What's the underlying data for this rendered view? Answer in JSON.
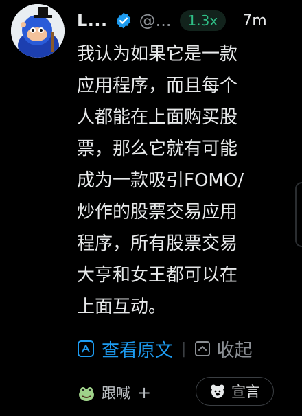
{
  "header": {
    "name": "L...",
    "handle": "@...",
    "speed": "1.3x",
    "time": "7m"
  },
  "post": {
    "text": "我认为如果它是一款\n应用程序，而且每个\n人都能在上面购买股\n票，那么它就有可能\n成为一款吸引FOMO/\n炒作的股票交易应用\n程序，所有股票交易\n大亨和女王都可以在\n上面互动。"
  },
  "actions": {
    "view_original": "查看原文",
    "separator": "|",
    "collapse": "收起"
  },
  "bottom": {
    "follow": "跟喊",
    "follow_plus": "+",
    "declare": "宣言"
  },
  "icons": {
    "verified": "verified-badge-icon",
    "translate": "translate-icon",
    "collapse": "collapse-icon",
    "follow": "frog-avatar-icon",
    "declare": "bear-icon"
  },
  "colors": {
    "background": "#000000",
    "text": "#e7e9ea",
    "muted": "#8b8f94",
    "accent_blue": "#1d9bf0",
    "speed_green": "#2fbf86",
    "speed_bg": "#12231c"
  }
}
